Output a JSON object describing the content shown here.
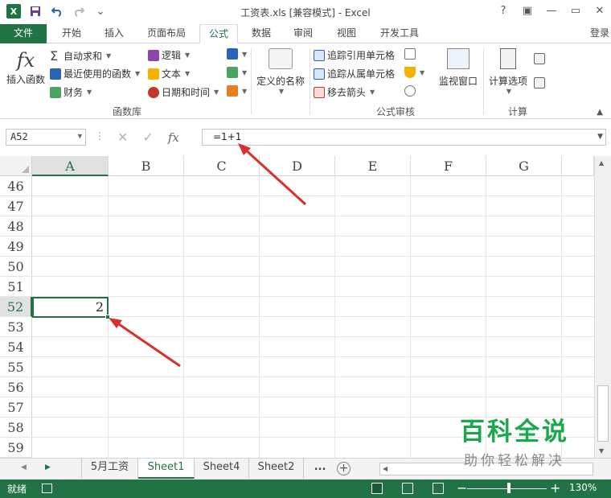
{
  "window": {
    "title": "工资表.xls  [兼容模式] - Excel",
    "help": "?",
    "ribbon_display": "▣",
    "minimize": "—",
    "restore": "▭",
    "close": "✕"
  },
  "qat": {
    "logo": "X",
    "save": "💾",
    "undo": "↶",
    "redo": "↷",
    "customize": "⌄"
  },
  "tabs": {
    "file": "文件",
    "items": [
      "开始",
      "插入",
      "页面布局",
      "公式",
      "数据",
      "审阅",
      "视图",
      "开发工具"
    ],
    "active": "公式",
    "login": "登录"
  },
  "ribbon": {
    "insert_function": "插入函数",
    "fx_glyph": "fx",
    "autosum": "自动求和",
    "recent": "最近使用的函数",
    "financial": "财务",
    "logical": "逻辑",
    "text": "文本",
    "datetime": "日期和时间",
    "function_library": "函数库",
    "define_name": "定义的名称",
    "trace_precedents": "追踪引用单元格",
    "trace_dependents": "追踪从属单元格",
    "remove_arrows": "移去箭头",
    "formula_auditing": "公式审核",
    "watch_window": "监视窗口",
    "calc_options": "计算选项",
    "calculation": "计算"
  },
  "formula_bar": {
    "name_box": "A52",
    "cancel": "✕",
    "enter": "✓",
    "fx": "fx",
    "formula": "=1+1"
  },
  "grid": {
    "columns": [
      "A",
      "B",
      "C",
      "D",
      "E",
      "F",
      "G"
    ],
    "selected_column": "A",
    "rows": [
      "46",
      "47",
      "48",
      "49",
      "50",
      "51",
      "52",
      "53",
      "54",
      "55",
      "56",
      "57",
      "58",
      "59"
    ],
    "selected_row": "52",
    "selected_cell_value": "2"
  },
  "sheets": {
    "tabs": [
      "5月工资",
      "Sheet1",
      "Sheet4",
      "Sheet2"
    ],
    "active": "Sheet1",
    "more": "...",
    "add": "+"
  },
  "status": {
    "text": "就绪",
    "zoom_minus": "−",
    "zoom_plus": "+",
    "zoom_level": "130%"
  },
  "watermark": {
    "main": "百科全说",
    "sub": "助你轻松解决"
  },
  "colors": {
    "accent": "#217346",
    "annotation": "#d9302c",
    "watermark": "#1aa84c"
  }
}
